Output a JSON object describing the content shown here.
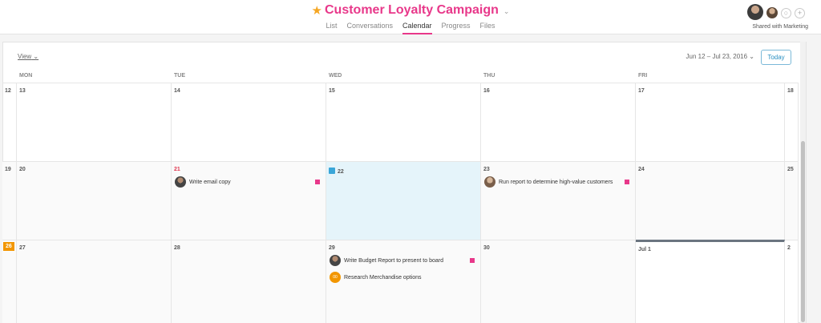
{
  "header": {
    "title": "Customer Loyalty Campaign",
    "tabs": [
      {
        "label": "List"
      },
      {
        "label": "Conversations"
      },
      {
        "label": "Calendar",
        "active": true
      },
      {
        "label": "Progress"
      },
      {
        "label": "Files"
      }
    ],
    "share_label": "Shared with Marketing"
  },
  "toolbar": {
    "view_label": "View",
    "range_label": "Jun 12 – Jul 23, 2016",
    "today_label": "Today"
  },
  "day_headers": [
    "MON",
    "TUE",
    "WED",
    "THU",
    "FRI"
  ],
  "weeks": [
    {
      "days": [
        "12",
        "13",
        "14",
        "15",
        "16",
        "17",
        "18"
      ]
    },
    {
      "days": [
        "19",
        "20",
        "21",
        "22",
        "23",
        "24",
        "25"
      ]
    },
    {
      "days": [
        "26",
        "27",
        "28",
        "29",
        "30",
        "Jul 1",
        "2"
      ]
    }
  ],
  "tasks": {
    "w2_tue": "Write email copy",
    "w2_thu": "Run report to determine high-value customers",
    "w3_wed_1": "Write Budget Report to present to board",
    "w3_wed_2": "Research Merchandise options",
    "w3_wed_2_initials": "00"
  },
  "colors": {
    "accent": "#e8388a",
    "today_highlight": "#e5f4fa",
    "today_badge": "#f29600",
    "star": "#f5a623"
  },
  "icons": [
    "star-icon",
    "chevron-down-icon",
    "add-member-icon",
    "calendar-icon"
  ]
}
